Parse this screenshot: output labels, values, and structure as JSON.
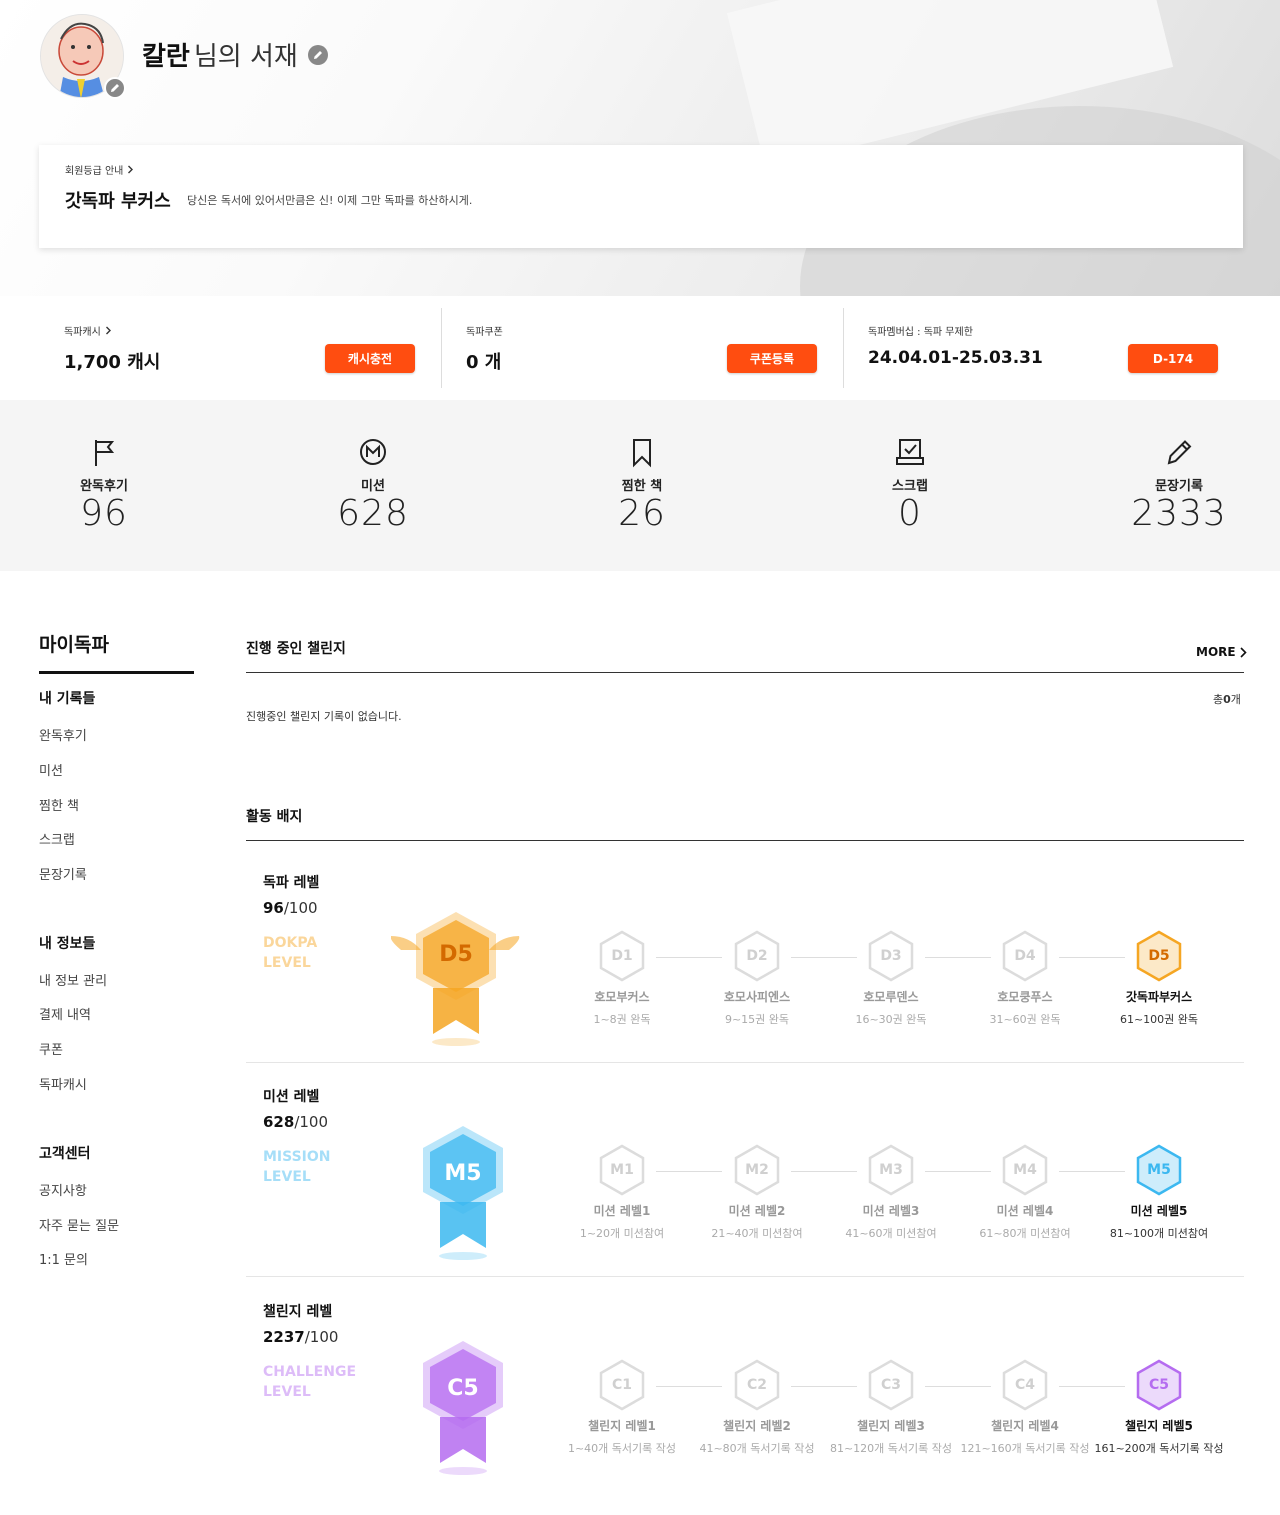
{
  "profile": {
    "name": "칼란",
    "suffix": "님의 서재"
  },
  "grade": {
    "link_label": "회원등급 안내",
    "name": "갓독파 부커스",
    "description": "당신은 독서에 있어서만큼은 신! 이제 그만 독파를 하산하시게."
  },
  "wallet": [
    {
      "label": "독파캐시",
      "value": "1,700 캐시",
      "button": "캐시충전",
      "has_arrow": true
    },
    {
      "label": "독파쿠폰",
      "value": "0 개",
      "button": "쿠폰등록",
      "has_arrow": false
    },
    {
      "label": "독파멤버십 : 독파 무제한",
      "value": "24.04.01-25.03.31",
      "button": "D-174",
      "has_arrow": false
    }
  ],
  "stats": [
    {
      "label": "완독후기",
      "value": "96",
      "icon": "flag-icon"
    },
    {
      "label": "미션",
      "value": "628",
      "icon": "mission-icon"
    },
    {
      "label": "찜한 책",
      "value": "26",
      "icon": "bookmark-icon"
    },
    {
      "label": "스크랩",
      "value": "0",
      "icon": "scrap-icon"
    },
    {
      "label": "문장기록",
      "value": "2333",
      "icon": "pencil-icon"
    }
  ],
  "sidebar": {
    "title": "마이독파",
    "sections": [
      {
        "title": "내 기록들",
        "items": [
          "완독후기",
          "미션",
          "찜한 책",
          "스크랩",
          "문장기록"
        ]
      },
      {
        "title": "내 정보들",
        "items": [
          "내 정보 관리",
          "결제 내역",
          "쿠폰",
          "독파캐시"
        ]
      },
      {
        "title": "고객센터",
        "items": [
          "공지사항",
          "자주 묻는 질문",
          "1:1 문의"
        ]
      }
    ]
  },
  "challenge": {
    "heading": "진행 중인 챌린지",
    "more": "MORE",
    "count_prefix": "총",
    "count_value": "0",
    "count_suffix": "개",
    "empty": "진행중인 챌린지 기록이 없습니다."
  },
  "badges": {
    "heading": "활동 배지",
    "levels": [
      {
        "title": "독파 레벨",
        "score": "96",
        "max": "/100",
        "en1": "DOKPA",
        "en2": "LEVEL",
        "medal": "D5",
        "color": "#f5a623",
        "steps": [
          {
            "code": "D1",
            "name": "호모부커스",
            "range": "1~8권 완독"
          },
          {
            "code": "D2",
            "name": "호모사피엔스",
            "range": "9~15권 완독"
          },
          {
            "code": "D3",
            "name": "호모루덴스",
            "range": "16~30권 완독"
          },
          {
            "code": "D4",
            "name": "호모쿵푸스",
            "range": "31~60권 완독"
          },
          {
            "code": "D5",
            "name": "갓독파부커스",
            "range": "61~100권 완독"
          }
        ]
      },
      {
        "title": "미션 레벨",
        "score": "628",
        "max": "/100",
        "en1": "MISSION",
        "en2": "LEVEL",
        "medal": "M5",
        "color": "#3cb8f0",
        "steps": [
          {
            "code": "M1",
            "name": "미션 레벨1",
            "range": "1~20개 미션참여"
          },
          {
            "code": "M2",
            "name": "미션 레벨2",
            "range": "21~40개 미션참여"
          },
          {
            "code": "M3",
            "name": "미션 레벨3",
            "range": "41~60개 미션참여"
          },
          {
            "code": "M4",
            "name": "미션 레벨4",
            "range": "61~80개 미션참여"
          },
          {
            "code": "M5",
            "name": "미션 레벨5",
            "range": "81~100개 미션참여"
          }
        ]
      },
      {
        "title": "챌린지 레벨",
        "score": "2237",
        "max": "/100",
        "en1": "CHALLENGE",
        "en2": "LEVEL",
        "medal": "C5",
        "color": "#b56cf0",
        "steps": [
          {
            "code": "C1",
            "name": "챌린지 레벨1",
            "range": "1~40개 독서기록 작성"
          },
          {
            "code": "C2",
            "name": "챌린지 레벨2",
            "range": "41~80개 독서기록 작성"
          },
          {
            "code": "C3",
            "name": "챌린지 레벨3",
            "range": "81~120개 독서기록 작성"
          },
          {
            "code": "C4",
            "name": "챌린지 레벨4",
            "range": "121~160개 독서기록 작성"
          },
          {
            "code": "C5",
            "name": "챌린지 레벨5",
            "range": "161~200개 독서기록 작성"
          }
        ]
      }
    ]
  },
  "colors": {
    "accent": "#ff4d10"
  }
}
